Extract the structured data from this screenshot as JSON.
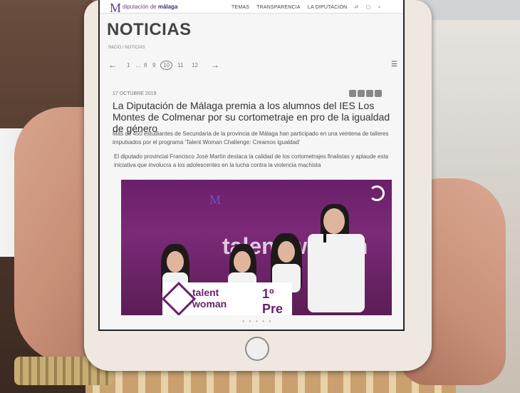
{
  "photo": {
    "device": "tablet",
    "colors": {
      "tablet_frame": "#efe8e1",
      "accent_purple": "#6a1f6a",
      "brand_purple": "#5a3fa0"
    }
  },
  "site": {
    "logo_glyph": "M",
    "logo_prefix": "diputación de",
    "logo_name": "málaga",
    "nav": [
      "TEMAS",
      "TRANSPARENCIA",
      "LA DIPUTACIÓN"
    ],
    "nav_icons": [
      "language-icon",
      "help-icon",
      "search-icon"
    ]
  },
  "page": {
    "title": "NOTICIAS",
    "breadcrumb": "INICIO / NOTICIAS",
    "pager": {
      "prev": "←",
      "next": "→",
      "pages": [
        "1",
        "…",
        "8",
        "9",
        "10",
        "11",
        "12"
      ],
      "current": "10"
    }
  },
  "article": {
    "date": "17 OCTUBRE 2019",
    "headline": "La Diputación de Málaga premia a los alumnos del IES Los Montes de Colmenar por su cortometraje en pro de la igualdad de género",
    "lead": "Más de 450 estudiantes de Secundaria de la provincia de Málaga han participado en una veintena de talleres impulsados por el programa 'Talent Woman Challenge: Creamos igualdad'",
    "body": "El diputado provincial Francisco José Martín destaca la calidad de los cortometrajes finalistas y aplaude esta iniciativa que involucra a los adolescentes en la lucha contra la violencia machista"
  },
  "hero_image": {
    "backdrop_text": "talent woman",
    "banner_line1": "talent",
    "banner_line2": "woman",
    "banner_prize": "1º Pre"
  },
  "carousel": {
    "dots": "● ● ● ● ●"
  }
}
